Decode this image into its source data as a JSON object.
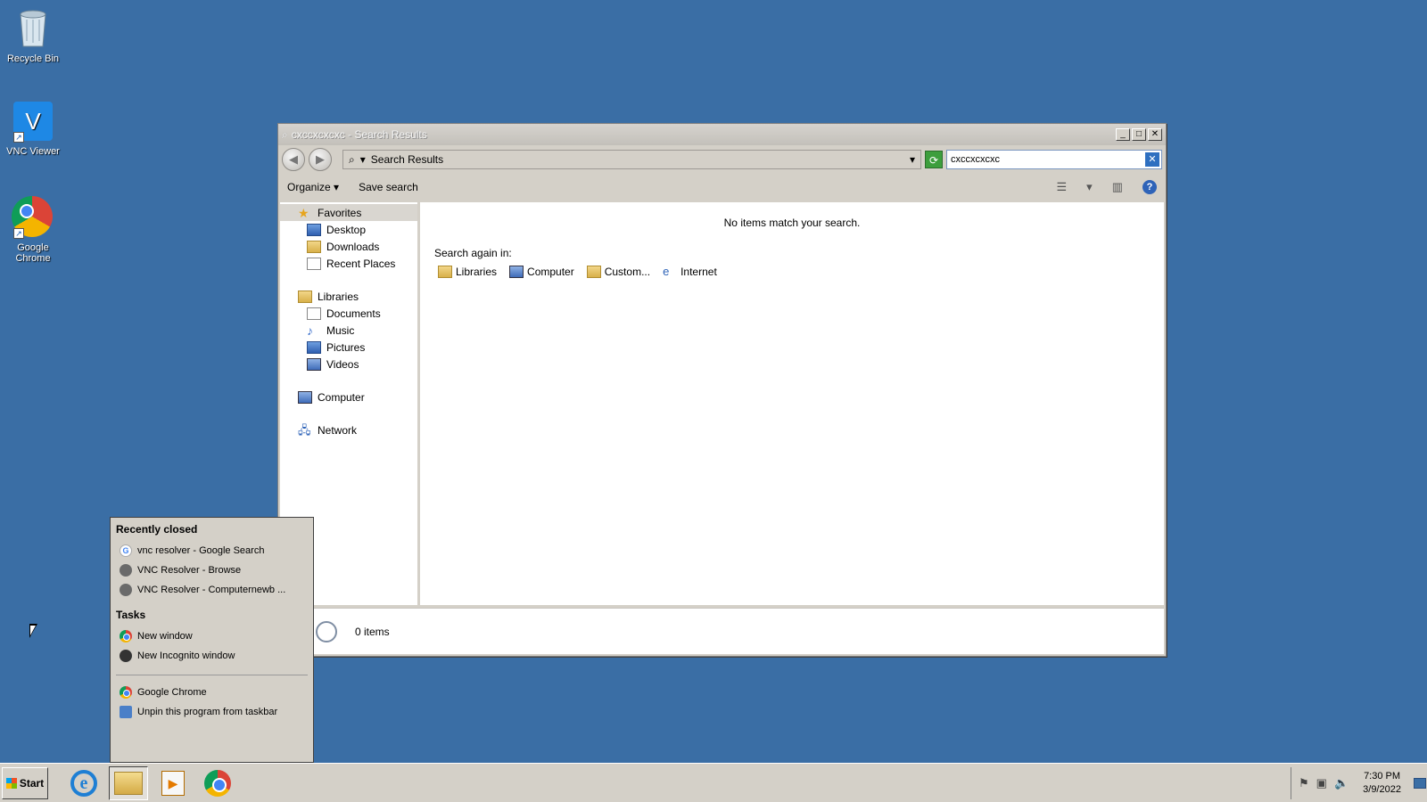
{
  "desktop": {
    "icons": [
      {
        "label": "Recycle Bin",
        "icon": "recycle-bin-icon"
      },
      {
        "label": "VNC Viewer",
        "icon": "vnc-viewer-icon"
      },
      {
        "label": "Google Chrome",
        "icon": "chrome-icon"
      }
    ]
  },
  "window": {
    "title": "cxccxcxcxc - Search Results",
    "address": "Search Results",
    "search_value": "cxccxcxcxc",
    "toolbar": {
      "organize": "Organize",
      "save_search": "Save search"
    },
    "nav": {
      "favorites": "Favorites",
      "favorites_items": [
        "Desktop",
        "Downloads",
        "Recent Places"
      ],
      "libraries": "Libraries",
      "libraries_items": [
        "Documents",
        "Music",
        "Pictures",
        "Videos"
      ],
      "computer": "Computer",
      "network": "Network"
    },
    "content": {
      "no_items": "No items match your search.",
      "search_again": "Search again in:",
      "targets": [
        "Libraries",
        "Computer",
        "Custom...",
        "Internet"
      ]
    },
    "status": "0 items"
  },
  "jumplist": {
    "recently_closed_heading": "Recently closed",
    "recent": [
      "vnc resolver - Google Search",
      "VNC Resolver - Browse",
      "VNC Resolver - Computernewb ..."
    ],
    "tasks_heading": "Tasks",
    "tasks": [
      "New window",
      "New Incognito window"
    ],
    "app_name": "Google Chrome",
    "unpin": "Unpin this program from taskbar"
  },
  "taskbar": {
    "start": "Start",
    "time": "7:30 PM",
    "date": "3/9/2022"
  },
  "colors": {
    "desktop": "#3a6ea5",
    "chrome_face": "#d4d0c8"
  }
}
